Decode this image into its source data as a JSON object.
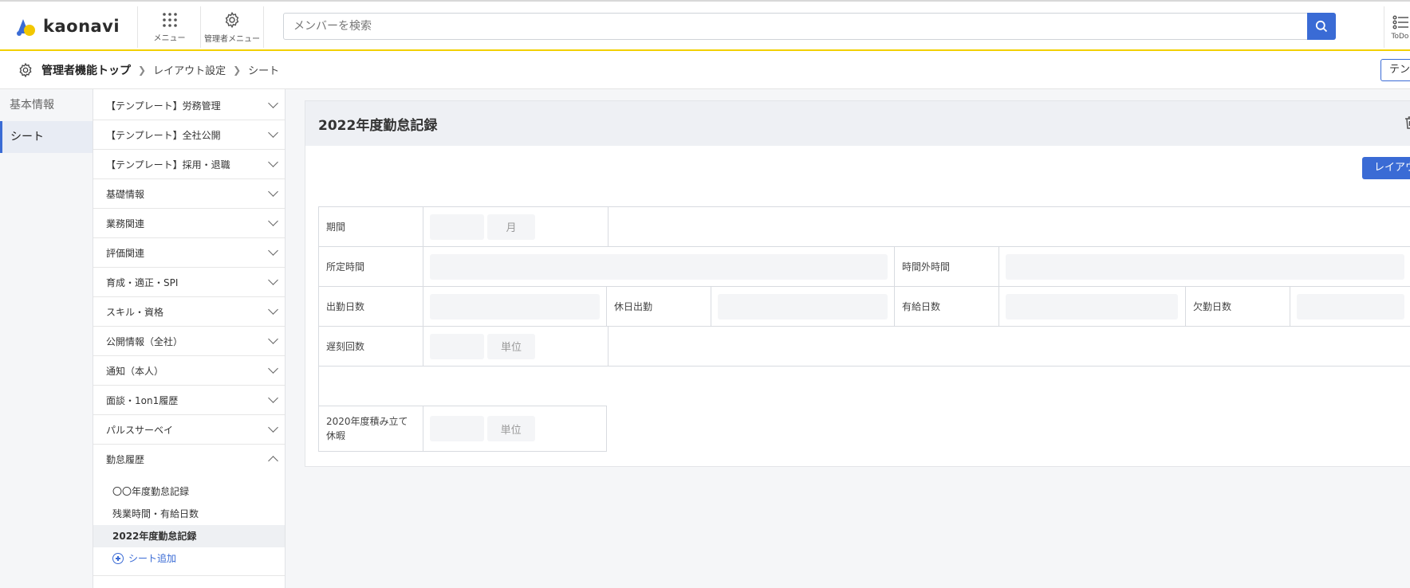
{
  "header": {
    "logo_text": "kaonavi",
    "menu_label": "メニュー",
    "admin_menu_label": "管理者メニュー",
    "search_placeholder": "メンバーを検索",
    "todo_label": "ToDo"
  },
  "breadcrumb": {
    "top": "管理者機能トップ",
    "items": [
      "レイアウト設定",
      "シート"
    ],
    "right_button": "テンプレート"
  },
  "leftnav": {
    "items": [
      {
        "label": "基本情報",
        "active": false
      },
      {
        "label": "シート",
        "active": true
      }
    ]
  },
  "categories": [
    {
      "label": "【テンプレート】労務管理"
    },
    {
      "label": "【テンプレート】全社公開"
    },
    {
      "label": "【テンプレート】採用・退職"
    },
    {
      "label": "基礎情報"
    },
    {
      "label": "業務関連"
    },
    {
      "label": "評価関連"
    },
    {
      "label": "育成・適正・SPI"
    },
    {
      "label": "スキル・資格"
    },
    {
      "label": "公開情報（全社）"
    },
    {
      "label": "通知（本人）"
    },
    {
      "label": "面談・1on1履歴"
    },
    {
      "label": "パルスサーベイ"
    },
    {
      "label": "勤怠履歴",
      "open": true
    }
  ],
  "subitems": [
    {
      "label": "〇〇年度勤怠記録"
    },
    {
      "label": "残業時間・有給日数"
    },
    {
      "label": "2022年度勤怠記録",
      "active": true
    }
  ],
  "add_sheet_label": "シート追加",
  "sheet": {
    "title": "2022年度勤怠記録",
    "layout_button": "レイアウト編集",
    "fields": {
      "period": {
        "label": "期間",
        "unit": "月"
      },
      "scheduled_hours": {
        "label": "所定時間"
      },
      "overtime_hours": {
        "label": "時間外時間"
      },
      "work_days": {
        "label": "出勤日数"
      },
      "holiday_work": {
        "label": "休日出勤"
      },
      "paid_leave_days": {
        "label": "有給日数"
      },
      "absence_days": {
        "label": "欠勤日数"
      },
      "late_count": {
        "label": "遅刻回数",
        "unit": "単位"
      },
      "accum_leave": {
        "label": "2020年度積み立て休暇",
        "unit": "単位"
      }
    }
  }
}
